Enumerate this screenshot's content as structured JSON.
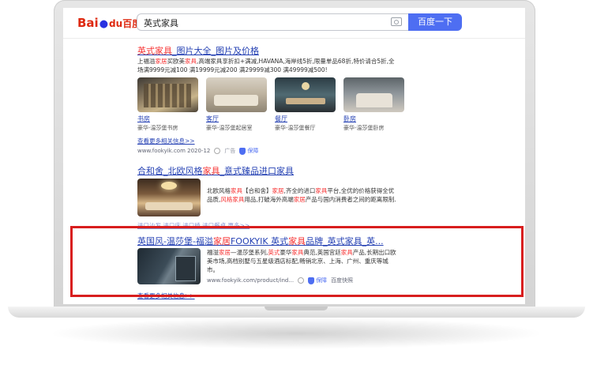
{
  "search": {
    "logo": {
      "part1": "Bai",
      "part2": "du",
      "part3": "百度"
    },
    "query": "英式家具",
    "button_label": "百度一下"
  },
  "result1": {
    "title_pre": "英式家具",
    "title_post": "_图片大全_图片及价格",
    "desc_line1": [
      "上福溢",
      "家居",
      "买欧美",
      "家具",
      ",高端家具享折扣+满减,HAVANA,海岸线5折,限量单品68折,特价请合5折,全"
    ],
    "desc_line2": "场满9999元减100 满19999元减200 满29999减300 满49999减500!",
    "thumbs": [
      {
        "label": "书房",
        "sub": "豪华-温莎堡书房"
      },
      {
        "label": "客厅",
        "sub": "豪华-温莎堡起居室"
      },
      {
        "label": "餐厅",
        "sub": "豪华-温莎堡餐厅"
      },
      {
        "label": "卧房",
        "sub": "豪华-温莎堡卧房"
      }
    ],
    "more": "查看更多相关信息>>",
    "url": "www.fookyik.com 2020-12",
    "ad": "广告",
    "badge": "保障"
  },
  "result2": {
    "title_pre": "合和舍_北欧风格",
    "title_red": "家具",
    "title_post": "_意式臻品进口家具",
    "desc_line1": [
      "北欧风格",
      "家具",
      "【合和舍】",
      "家居",
      ",齐全的进口",
      "家具",
      "平台,全优的价格获得全优"
    ],
    "desc_line2": [
      "品质,",
      "风格",
      "家具",
      "用品,打破海外高端",
      "家居",
      "产品与国内消费者之间的距离限制."
    ],
    "links": "进口沙发  进口床  进口椅  进口餐桌  更多>>"
  },
  "result3": {
    "title_pre": "英国风-温莎堡-福溢",
    "title_red": "家居",
    "title_mid": "FOOKYIK 英式",
    "title_red2": "家具",
    "title_post": "品牌_英式家具_英...",
    "desc_line1": [
      "福溢",
      "家居",
      "—温莎堡系列,",
      "英式",
      "豪华",
      "家具",
      "典范,英国宫廷",
      "家具",
      "产品,长期出口欧"
    ],
    "desc_line2": "美市场,高档别墅与五星级酒店标配,畅销北京、上海、广州、重庆等城",
    "desc_line3": "市。",
    "url": "www.fookyik.com/product/ind...",
    "badge": "保障",
    "snapshot": "百度快照",
    "more": "查看更多相关信息>>"
  },
  "colors": {
    "accent": "#4e6ef2",
    "link": "#2440b3",
    "highlight": "#f73131",
    "frame": "#d81e1e"
  }
}
